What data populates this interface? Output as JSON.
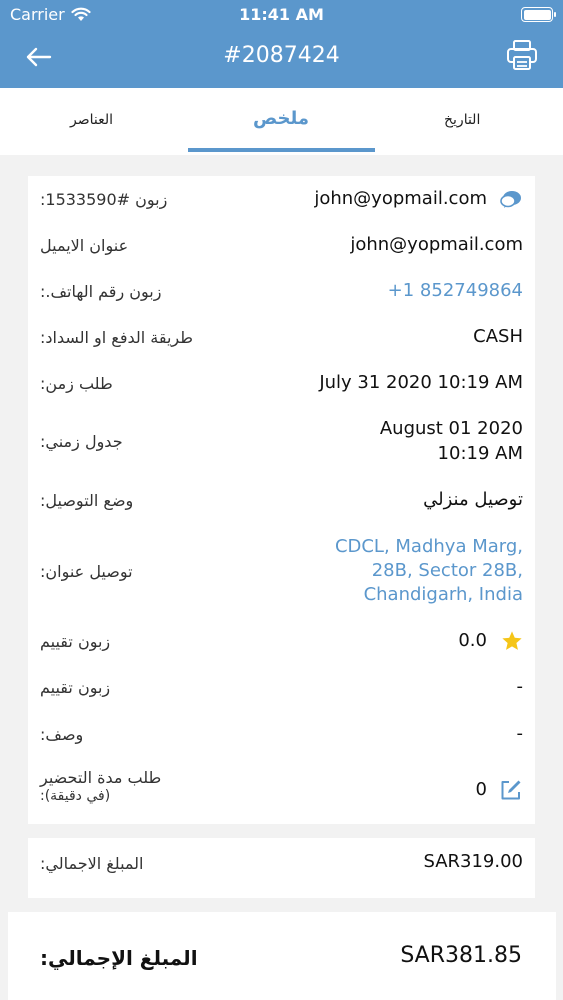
{
  "status_bar": {
    "carrier": "Carrier",
    "time": "11:41 AM"
  },
  "header": {
    "title": "#2087424",
    "background": "#5b97cc"
  },
  "tabs": [
    {
      "label": "العناصر"
    },
    {
      "label": "ملخص",
      "active": true
    },
    {
      "label": "التاريخ"
    }
  ],
  "details": {
    "customer_label": "زبون #1533590:",
    "customer_value": "john@yopmail.com",
    "email_label": "عنوان الايميل",
    "email_value": "john@yopmail.com",
    "phone_label": "زبون رقم الهاتف.:",
    "phone_value": "+1 852749864",
    "payment_label": "طريقة الدفع او السداد:",
    "payment_value": "CASH",
    "order_time_label": "طلب زمن:",
    "order_time_value": "July 31 2020 10:19 AM",
    "schedule_label": "جدول زمني:",
    "schedule_value_line1": "August 01 2020",
    "schedule_value_line2": "10:19 AM",
    "delivery_mode_label": "وضع التوصيل:",
    "delivery_mode_value": "توصيل منزلي",
    "address_label": "توصيل عنوان:",
    "address_line1": "CDCL, Madhya Marg,",
    "address_line2": "28B, Sector 28B,",
    "address_line3": "Chandigarh, India",
    "rating_label": "زبون تقييم",
    "rating_value": "0.0",
    "rating2_label": "زبون تقييم",
    "rating2_value": "-",
    "description_label": "وصف:",
    "description_value": "-",
    "prep_label_line1": "طلب مدة التحضير",
    "prep_label_line2": "(في دقيقة):",
    "prep_value": "0"
  },
  "subtotal": {
    "label": "المبلغ الاجمالي:",
    "value": "SAR319.00"
  },
  "grand_total": {
    "label": "المبلغ الإجمالي:",
    "value": "SAR381.85"
  },
  "colors": {
    "accent": "#5b97cc",
    "star": "#f5c518"
  }
}
